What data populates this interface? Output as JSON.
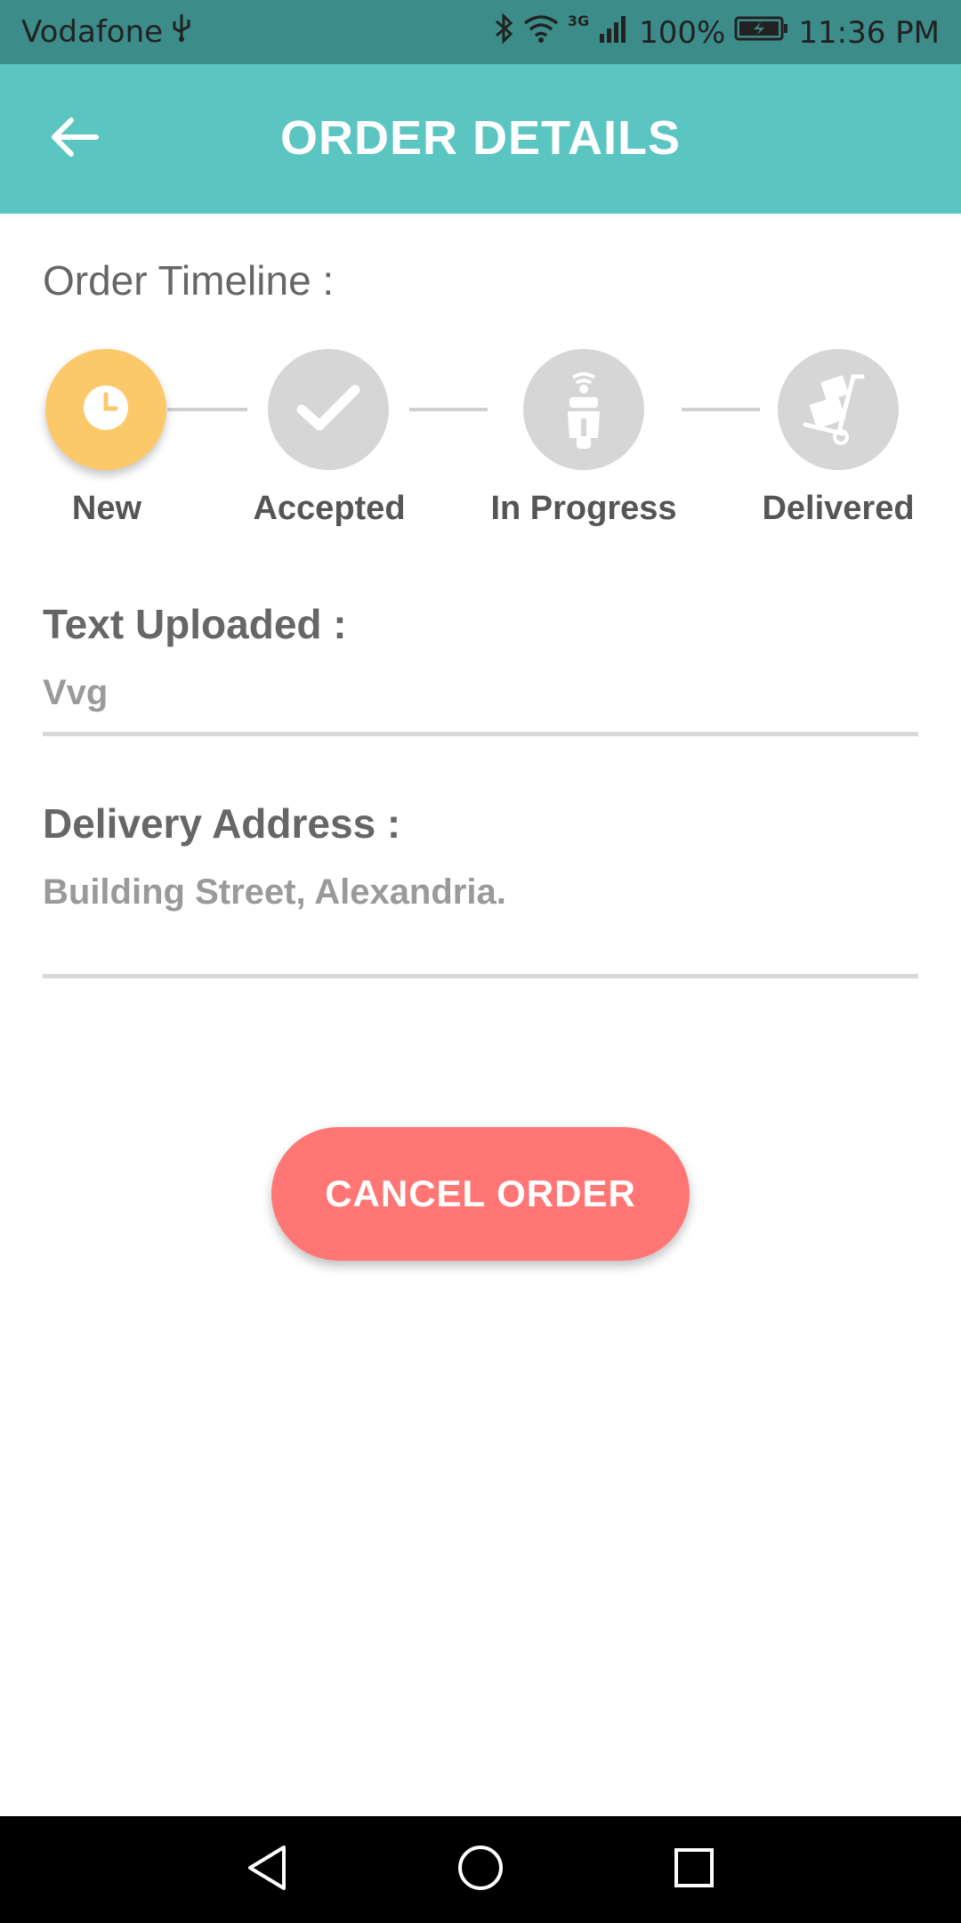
{
  "status_bar": {
    "carrier": "Vodafone",
    "network_type": "3G",
    "battery": "100%",
    "time": "11:36 PM",
    "icons": [
      "usb-icon",
      "bluetooth-icon",
      "wifi-icon",
      "signal-icon",
      "battery-charging-icon"
    ]
  },
  "app_bar": {
    "title": "ORDER DETAILS",
    "back_icon": "arrow-left-icon",
    "background": "#5bc5c1"
  },
  "timeline": {
    "title": "Order Timeline :",
    "active_color": "#fcc96a",
    "inactive_color": "#d6d6d6",
    "steps": [
      {
        "label": "New",
        "icon": "clock-icon",
        "active": true
      },
      {
        "label": "Accepted",
        "icon": "check-icon",
        "active": false
      },
      {
        "label": "In Progress",
        "icon": "scooter-icon",
        "active": false
      },
      {
        "label": "Delivered",
        "icon": "hand-truck-icon",
        "active": false
      }
    ]
  },
  "fields": {
    "text_uploaded": {
      "label": "Text Uploaded :",
      "value": "Vvg"
    },
    "delivery_address": {
      "label": "Delivery Address :",
      "value": "Building Street, Alexandria."
    }
  },
  "actions": {
    "cancel_label": "CANCEL ORDER",
    "cancel_color": "#ff7675"
  },
  "nav_bar": {
    "icons": [
      "back-triangle-icon",
      "home-circle-icon",
      "recents-square-icon"
    ]
  }
}
